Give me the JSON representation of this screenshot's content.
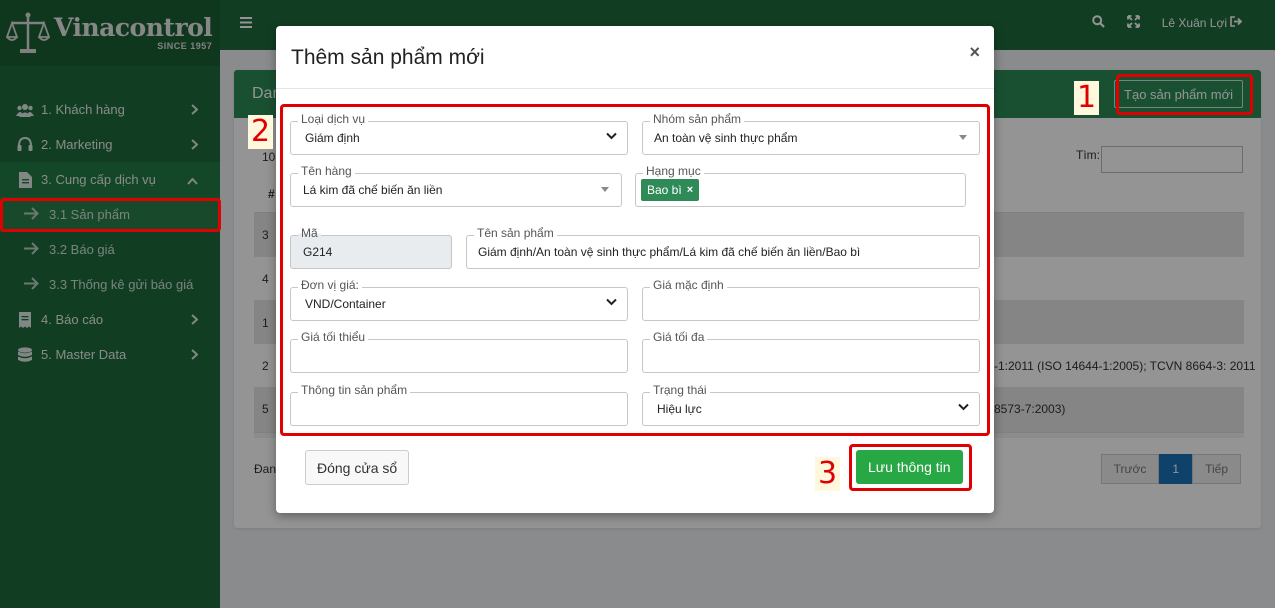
{
  "brand": {
    "name": "Vinacontrol",
    "since": "SINCE 1957"
  },
  "sidebar": {
    "items": [
      {
        "label": "1. Khách hàng",
        "icon": "users-icon"
      },
      {
        "label": "2. Marketing",
        "icon": "headset-icon"
      },
      {
        "label": "3. Cung cấp dịch vụ",
        "icon": "file-icon"
      },
      {
        "label": "4. Báo cáo",
        "icon": "receipt-icon"
      },
      {
        "label": "5. Master Data",
        "icon": "database-icon"
      }
    ],
    "subitems": [
      {
        "label": "3.1 Sản phẩm"
      },
      {
        "label": "3.2 Báo giá"
      },
      {
        "label": "3.3 Thống kê gửi báo giá"
      }
    ]
  },
  "topbar": {
    "user": "Lê Xuân Lợi"
  },
  "page": {
    "title_partial": "Dan",
    "create_button": "Tạo sản phẩm mới",
    "length_partial": "10",
    "search_label": "Tìm:",
    "header_hash": "#",
    "rows": [
      {
        "num": "3",
        "text": ""
      },
      {
        "num": "4",
        "text": ""
      },
      {
        "num": "1",
        "text": ""
      },
      {
        "num": "2",
        "text": "-1:2011 (ISO 14644-1:2005); TCVN 8664-3: 2011"
      },
      {
        "num": "5",
        "text": "8573-7:2003)"
      }
    ],
    "info_partial": "Đang",
    "pager": {
      "prev": "Trước",
      "current": "1",
      "next": "Tiếp"
    }
  },
  "modal": {
    "title": "Thêm sản phẩm mới",
    "close_icon": "×",
    "fields": {
      "service_type": {
        "label": "Loại dịch vụ",
        "value": "Giám định"
      },
      "product_group": {
        "label": "Nhóm sản phẩm",
        "value": "An toàn vệ sinh thực phẩm"
      },
      "goods_name": {
        "label": "Tên hàng",
        "value": "Lá kim đã chế biến ăn liền"
      },
      "category": {
        "label": "Hạng mục",
        "tag": "Bao bì",
        "tag_remove": "×"
      },
      "code": {
        "label": "Mã",
        "value": "G214"
      },
      "product_name": {
        "label": "Tên sản phẩm",
        "value": "Giám định/An toàn vệ sinh thực phẩm/Lá kim đã chế biến ăn liền/Bao bì"
      },
      "price_unit": {
        "label": "Đơn vị giá:",
        "value": "VND/Container"
      },
      "default_price": {
        "label": "Giá mặc định",
        "value": ""
      },
      "min_price": {
        "label": "Giá tối thiểu",
        "value": ""
      },
      "max_price": {
        "label": "Giá tối đa",
        "value": ""
      },
      "product_info": {
        "label": "Thông tin sản phẩm",
        "value": ""
      },
      "status": {
        "label": "Trạng thái",
        "value": "Hiệu lực"
      }
    },
    "close_button": "Đóng cửa sổ",
    "save_button": "Lưu thông tin"
  },
  "annotations": {
    "one": "1",
    "two": "2",
    "three": "3",
    "color": "#e00000"
  }
}
